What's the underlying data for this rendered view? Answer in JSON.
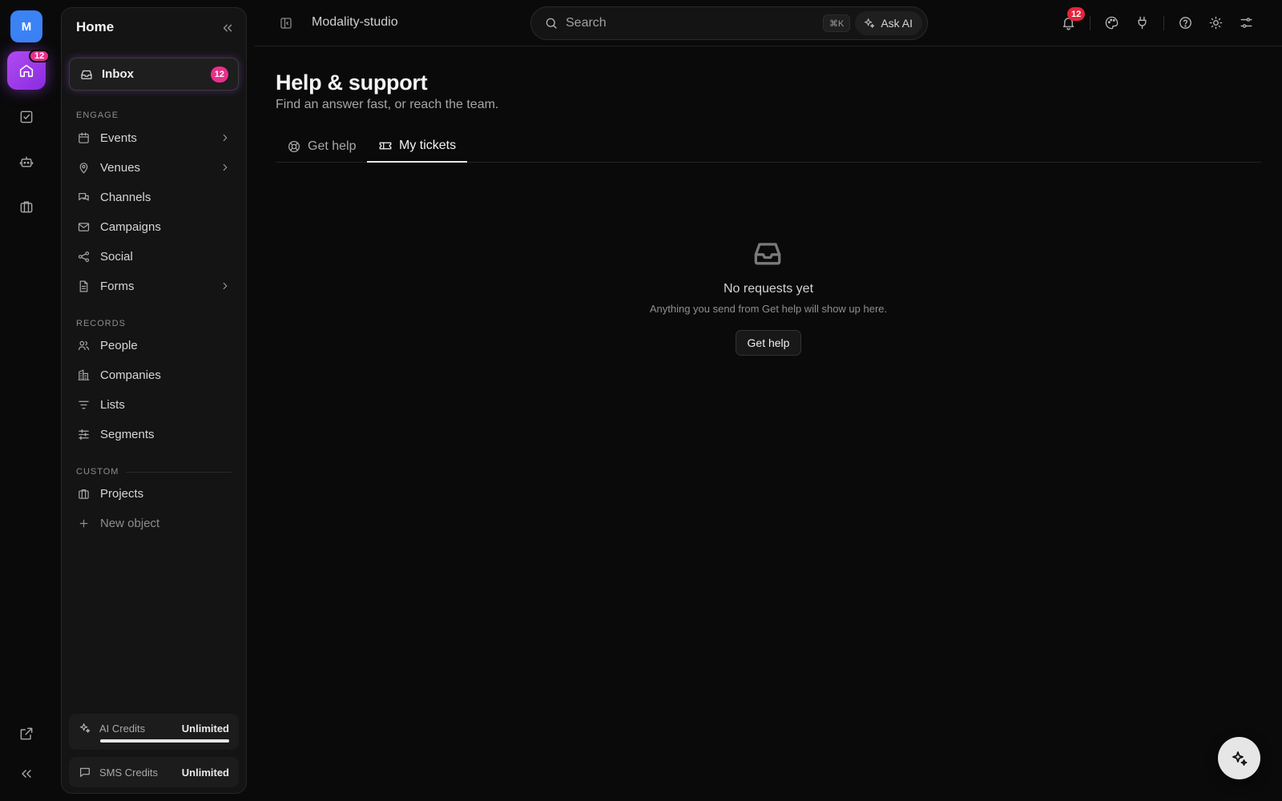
{
  "rail": {
    "workspace_initial": "M",
    "home_badge": "12"
  },
  "sidebar": {
    "title": "Home",
    "inbox": {
      "label": "Inbox",
      "badge": "12"
    },
    "sections": {
      "engage": "ENGAGE",
      "records": "RECORDS",
      "custom": "CUSTOM"
    },
    "engage_items": [
      {
        "label": "Events",
        "icon": "calendar-icon",
        "chevron": true
      },
      {
        "label": "Venues",
        "icon": "map-pin-icon",
        "chevron": true
      },
      {
        "label": "Channels",
        "icon": "chat-icon",
        "chevron": false
      },
      {
        "label": "Campaigns",
        "icon": "mail-icon",
        "chevron": false
      },
      {
        "label": "Social",
        "icon": "share-icon",
        "chevron": false
      },
      {
        "label": "Forms",
        "icon": "document-icon",
        "chevron": true
      }
    ],
    "records_items": [
      {
        "label": "People",
        "icon": "users-icon"
      },
      {
        "label": "Companies",
        "icon": "building-icon"
      },
      {
        "label": "Lists",
        "icon": "list-icon"
      },
      {
        "label": "Segments",
        "icon": "sliders-icon"
      }
    ],
    "custom_items": [
      {
        "label": "Projects",
        "icon": "briefcase-icon"
      }
    ],
    "new_object": "New object",
    "credits": {
      "ai": {
        "label": "AI Credits",
        "value": "Unlimited",
        "progress": 1.0
      },
      "sms": {
        "label": "SMS Credits",
        "value": "Unlimited"
      }
    }
  },
  "topbar": {
    "workspace_name": "Modality-studio",
    "search_placeholder": "Search",
    "search_shortcut": "⌘K",
    "ask_ai": "Ask AI",
    "notification_badge": "12"
  },
  "main": {
    "title": "Help & support",
    "subtitle": "Find an answer fast, or reach the team.",
    "tabs": [
      {
        "label": "Get help",
        "icon": "lifebuoy-icon",
        "active": false
      },
      {
        "label": "My tickets",
        "icon": "ticket-icon",
        "active": true
      }
    ],
    "empty": {
      "title": "No requests yet",
      "subtitle": "Anything you send from Get help will show up here.",
      "button": "Get help"
    }
  },
  "colors": {
    "accent_purple": "#a855f7",
    "badge_pink": "#e8308a",
    "badge_red": "#e5243b",
    "workspace_blue": "#3b82f6",
    "background": "#0a0a0a"
  }
}
